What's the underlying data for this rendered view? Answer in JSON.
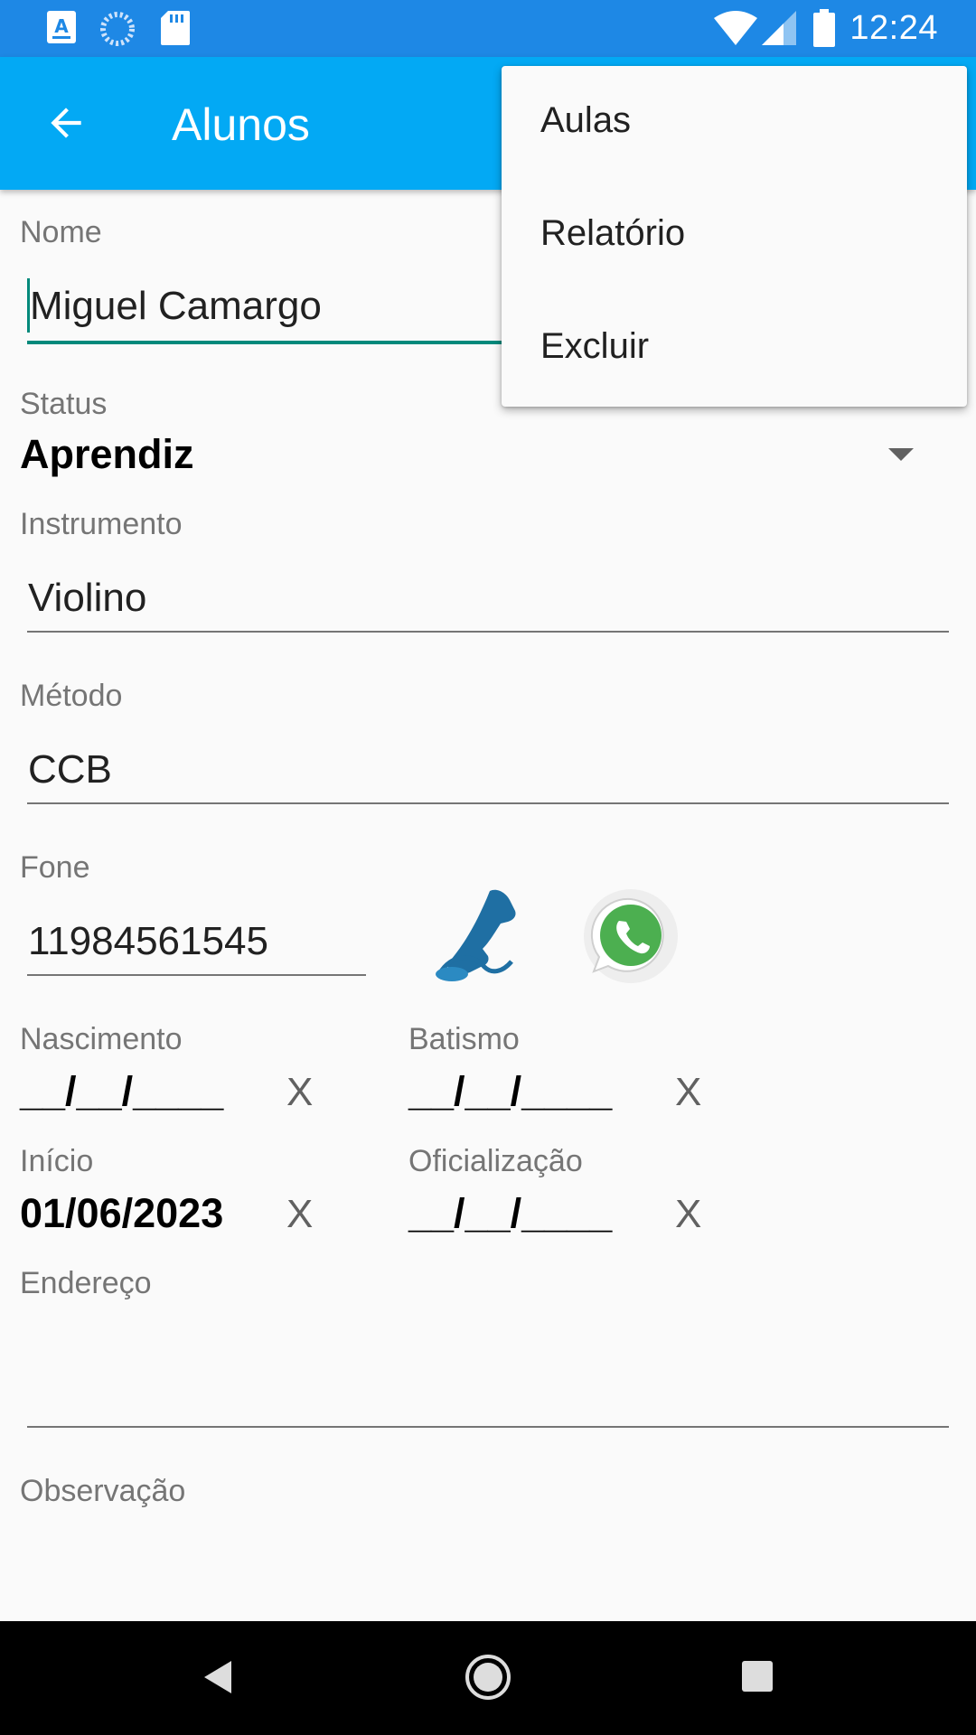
{
  "status_bar": {
    "time": "12:24",
    "icons": [
      "accessibility-icon",
      "loading-icon",
      "sd-card-icon",
      "wifi-icon",
      "cell-signal-icon",
      "battery-icon"
    ],
    "color": "#1e88e5"
  },
  "app_bar": {
    "title": "Alunos",
    "back_icon": "arrow-back-icon",
    "color": "#03a9f4"
  },
  "form": {
    "nome": {
      "label": "Nome",
      "value": "Miguel Camargo"
    },
    "status": {
      "label": "Status",
      "value": "Aprendiz"
    },
    "instrumento": {
      "label": "Instrumento",
      "value": "Violino"
    },
    "metodo": {
      "label": "Método",
      "value": "CCB"
    },
    "fone": {
      "label": "Fone",
      "value": "11984561545",
      "call_icon": "phone-icon",
      "whatsapp_icon": "whatsapp-icon"
    },
    "nascimento": {
      "label": "Nascimento",
      "value": "__/__/____",
      "clear": "X"
    },
    "batismo": {
      "label": "Batismo",
      "value": "__/__/____",
      "clear": "X"
    },
    "inicio": {
      "label": "Início",
      "value": "01/06/2023",
      "clear": "X"
    },
    "oficializacao": {
      "label": "Oficialização",
      "value": "__/__/____",
      "clear": "X"
    },
    "endereco": {
      "label": "Endereço",
      "value": ""
    },
    "observacao": {
      "label": "Observação",
      "value": ""
    }
  },
  "menu": {
    "items": [
      {
        "label": "Aulas"
      },
      {
        "label": "Relatório"
      },
      {
        "label": "Excluir"
      }
    ]
  },
  "accent_color": "#00897b",
  "nav_bar": {
    "icons": [
      "back-triangle-icon",
      "home-circle-icon",
      "recents-square-icon"
    ]
  }
}
